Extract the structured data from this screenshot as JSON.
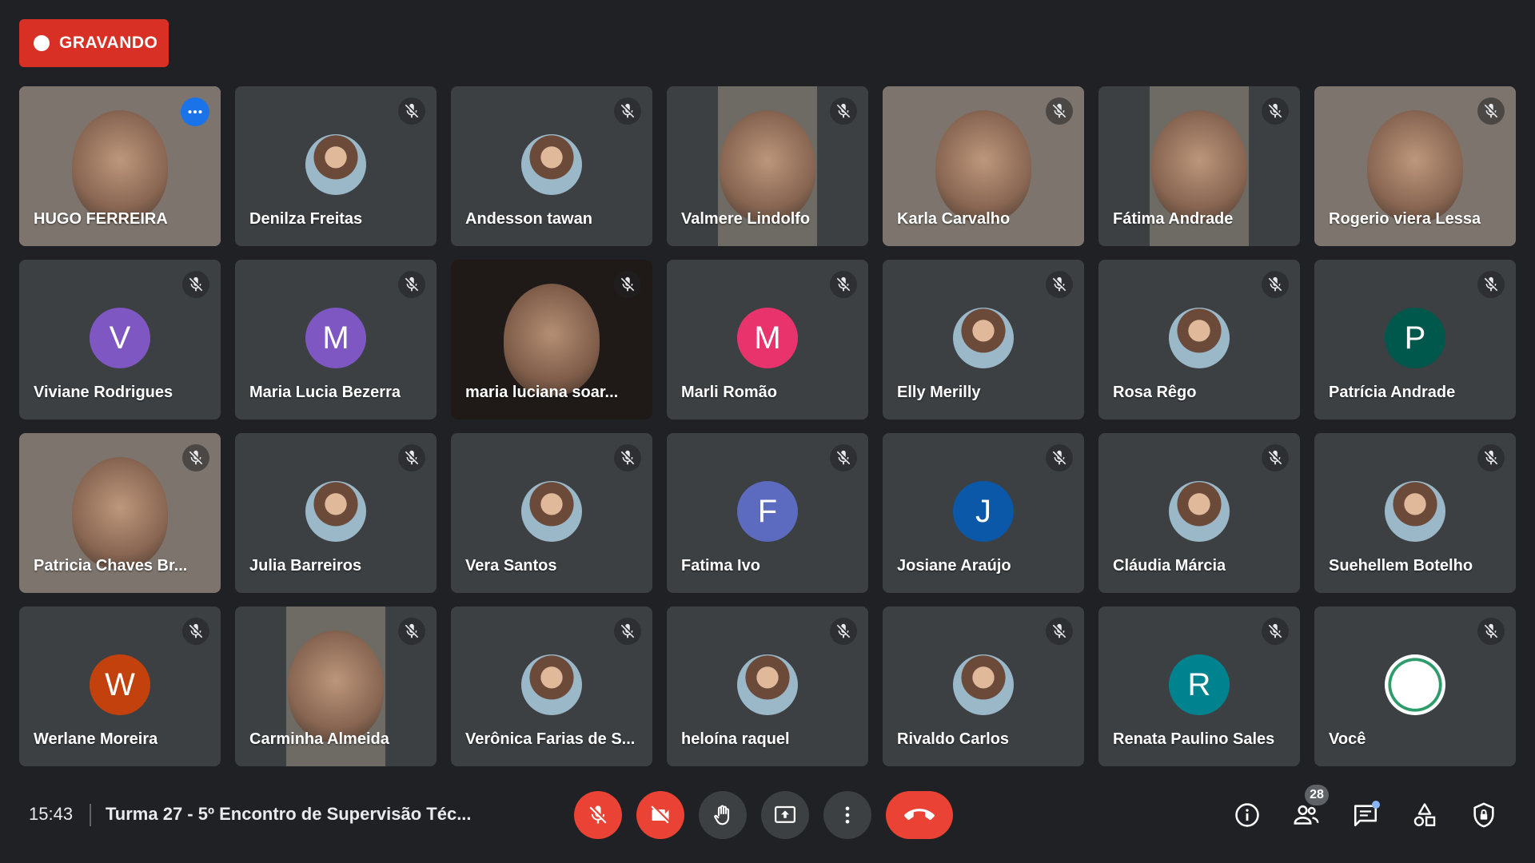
{
  "recording": {
    "label": "GRAVANDO"
  },
  "participants": [
    {
      "name": "HUGO FERREIRA",
      "kind": "video",
      "active": true
    },
    {
      "name": "Denilza Freitas",
      "kind": "photo"
    },
    {
      "name": "Andesson tawan",
      "kind": "photo"
    },
    {
      "name": "Valmere Lindolfo",
      "kind": "video-narrow"
    },
    {
      "name": "Karla Carvalho",
      "kind": "video"
    },
    {
      "name": "Fátima Andrade",
      "kind": "video-narrow"
    },
    {
      "name": "Rogerio viera Lessa",
      "kind": "video"
    },
    {
      "name": "Viviane Rodrigues",
      "kind": "letter",
      "letter": "V",
      "color": "#7e57c2"
    },
    {
      "name": "Maria Lucia Bezerra",
      "kind": "letter",
      "letter": "M",
      "color": "#7e57c2"
    },
    {
      "name": "maria luciana soar...",
      "kind": "video-dark"
    },
    {
      "name": "Marli Romão",
      "kind": "letter",
      "letter": "M",
      "color": "#e8336d"
    },
    {
      "name": "Elly Merilly",
      "kind": "photo"
    },
    {
      "name": "Rosa Rêgo",
      "kind": "photo"
    },
    {
      "name": "Patrícia Andrade",
      "kind": "letter",
      "letter": "P",
      "color": "#00574b"
    },
    {
      "name": "Patricia Chaves Br...",
      "kind": "video"
    },
    {
      "name": "Julia Barreiros",
      "kind": "photo"
    },
    {
      "name": "Vera Santos",
      "kind": "photo"
    },
    {
      "name": "Fatima Ivo",
      "kind": "letter",
      "letter": "F",
      "color": "#5c6bc0"
    },
    {
      "name": "Josiane Araújo",
      "kind": "letter",
      "letter": "J",
      "color": "#0b57a8"
    },
    {
      "name": "Cláudia Márcia",
      "kind": "photo"
    },
    {
      "name": "Suehellem Botelho",
      "kind": "photo"
    },
    {
      "name": "Werlane Moreira",
      "kind": "letter",
      "letter": "W",
      "color": "#c2410c"
    },
    {
      "name": "Carminha Almeida",
      "kind": "video-narrow"
    },
    {
      "name": "Verônica Farias de S...",
      "kind": "photo"
    },
    {
      "name": "heloína raquel",
      "kind": "photo"
    },
    {
      "name": "Rivaldo Carlos",
      "kind": "photo"
    },
    {
      "name": "Renata Paulino Sales",
      "kind": "letter",
      "letter": "R",
      "color": "#00838f"
    },
    {
      "name": "Você",
      "kind": "logo"
    }
  ],
  "meeting": {
    "time": "15:43",
    "title": "Turma 27 - 5º Encontro de Supervisão Téc..."
  },
  "controls": [
    {
      "name": "mic-off-button",
      "icon": "mic-off-icon"
    },
    {
      "name": "camera-off-button",
      "icon": "camera-off-icon"
    },
    {
      "name": "raise-hand-button",
      "icon": "hand-icon"
    },
    {
      "name": "present-button",
      "icon": "present-icon"
    },
    {
      "name": "more-options-button",
      "icon": "more-vert-icon"
    },
    {
      "name": "leave-call-button",
      "icon": "phone-end-icon"
    }
  ],
  "side": {
    "people_count": "28"
  },
  "colors": {
    "background": "#202124",
    "tile": "#3c4043",
    "danger": "#ea4335",
    "accent": "#8ab4f8"
  }
}
